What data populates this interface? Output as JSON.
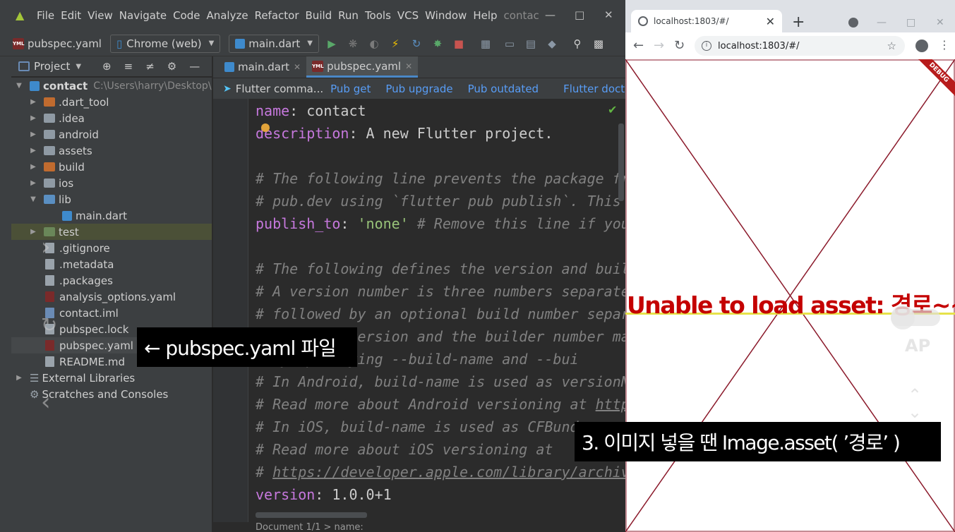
{
  "ide": {
    "menu": [
      "File",
      "Edit",
      "View",
      "Navigate",
      "Code",
      "Analyze",
      "Refactor",
      "Build",
      "Run",
      "Tools",
      "VCS",
      "Window",
      "Help"
    ],
    "window_title": "contac",
    "toolbar": {
      "current_file": "pubspec.yaml",
      "device": "Chrome (web)",
      "run_config": "main.dart"
    },
    "project_panel": {
      "title": "Project",
      "root_name": "contact",
      "root_path": "C:\\Users\\harry\\Desktop\\",
      "items": [
        {
          "label": ".dart_tool",
          "kind": "folder"
        },
        {
          "label": ".idea",
          "kind": "folder"
        },
        {
          "label": "android",
          "kind": "folder"
        },
        {
          "label": "assets",
          "kind": "folder"
        },
        {
          "label": "build",
          "kind": "folder"
        },
        {
          "label": "ios",
          "kind": "folder"
        },
        {
          "label": "lib",
          "kind": "folder"
        },
        {
          "label": "main.dart",
          "kind": "file"
        },
        {
          "label": "test",
          "kind": "folder"
        },
        {
          "label": ".gitignore",
          "kind": "file"
        },
        {
          "label": ".metadata",
          "kind": "file"
        },
        {
          "label": ".packages",
          "kind": "file"
        },
        {
          "label": "analysis_options.yaml",
          "kind": "file"
        },
        {
          "label": "contact.iml",
          "kind": "file"
        },
        {
          "label": "pubspec.lock",
          "kind": "file"
        },
        {
          "label": "pubspec.yaml",
          "kind": "file"
        },
        {
          "label": "README.md",
          "kind": "file"
        }
      ],
      "external_libraries": "External Libraries",
      "scratches": "Scratches and Consoles"
    },
    "tabs": [
      "main.dart",
      "pubspec.yaml"
    ],
    "flutter_bar": {
      "label": "Flutter comma...",
      "actions": [
        "Pub get",
        "Pub upgrade",
        "Pub outdated",
        "Flutter doctor"
      ]
    },
    "code": {
      "l1_key": "name",
      "l1_val": "contact",
      "l2_key": "description",
      "l2_val": "A new Flutter project.",
      "l4": "# The following line prevents the package fr",
      "l5": "# pub.dev using `flutter pub publish`. This",
      "l6_key": "publish_to",
      "l6_val": "'none'",
      "l6_comment": "# Remove this line if you",
      "l8": "# The following defines the version and buil",
      "l9": "# A version number is three numbers separate",
      "l10": "# followed by an optional build number separ",
      "l11": "# Both the version and the builder number ma",
      "l12": "# by specifying --build-name and --bui",
      "l13": "# In Android, build-name is used as versionN",
      "l14_pre": "# Read more about Android versioning at ",
      "l14_link": "http",
      "l15": "# In iOS, build-name is used as CFBund",
      "l16": "# Read more about iOS versioning at",
      "l17_pre": "# ",
      "l17_link": "https://developer.apple.com/library/archiv",
      "l18_key": "version",
      "l18_val": "1.0.0+1"
    },
    "status": "Document 1/1  >  name:"
  },
  "captions": {
    "arrow_label": "← pubspec.yaml 파일",
    "tip": "3. 이미지 넣을 땐 Image.asset( ’경로’ )"
  },
  "browser": {
    "tab_title": "localhost:1803/#/",
    "url": "localhost:1803/#/",
    "debug_banner": "DEBUG",
    "error_text": "Unable to load asset: 경로~~",
    "ghost_text": "AP"
  },
  "colors": {
    "error_text": "#c40000",
    "x_lines": "#8b1a2b",
    "keyword": "#c678dd",
    "string": "#98c379",
    "comment": "#808080",
    "link": "#589df6"
  }
}
